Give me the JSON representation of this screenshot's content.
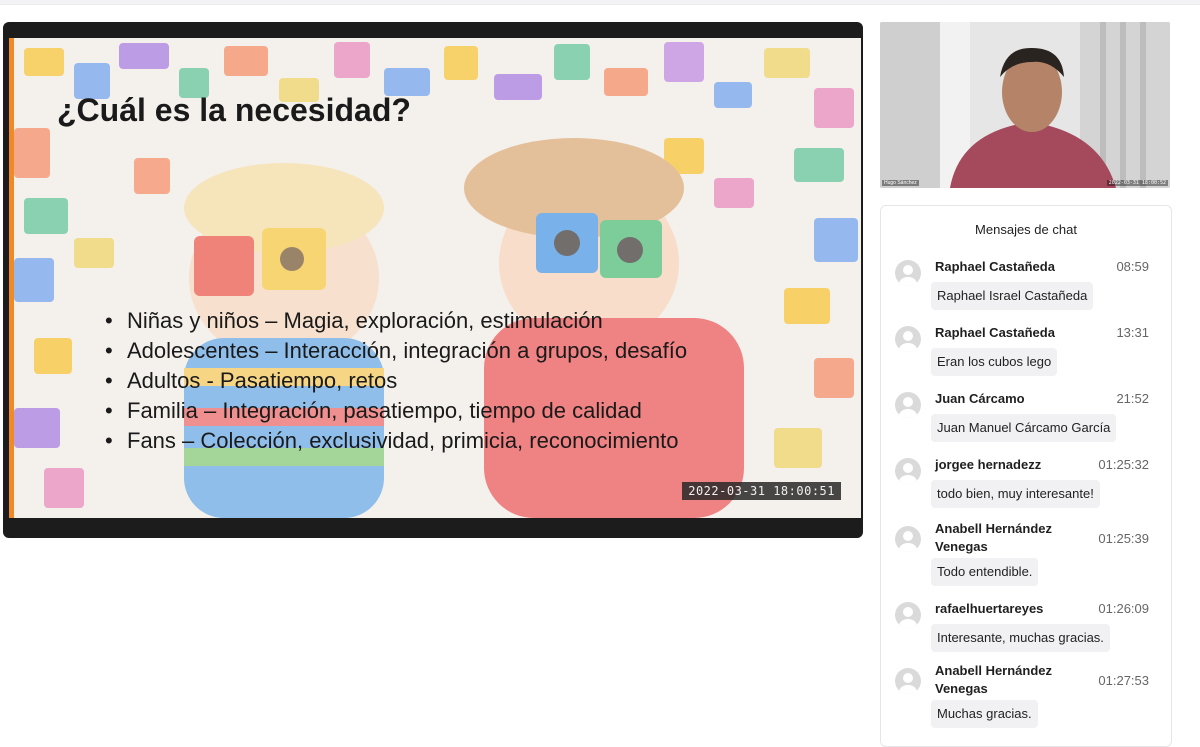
{
  "slide": {
    "title": "¿Cuál es la necesidad?",
    "bullets": [
      "Niñas y niños – Magia, exploración, estimulación",
      "Adolescentes – Interacción, integración a grupos, desafío",
      "Adultos - Pasatiempo, retos",
      "Familia – Integración, pasatiempo, tiempo de calidad",
      "Fans – Colección, exclusividad, primicia, reconocimiento"
    ],
    "timestamp": "2022-03-31  18:00:51",
    "accent_color": "#f08a24"
  },
  "webcam": {
    "name_tag": "Hugo Sánchez",
    "timestamp": "2022-03-31 18:00:52"
  },
  "chat": {
    "title": "Mensajes de chat",
    "messages": [
      {
        "author": "Raphael Castañeda",
        "time": "08:59",
        "text": "Raphael Israel Castañeda"
      },
      {
        "author": "Raphael Castañeda",
        "time": "13:31",
        "text": "Eran los cubos lego"
      },
      {
        "author": "Juan Cárcamo",
        "time": "21:52",
        "text": "Juan Manuel Cárcamo García"
      },
      {
        "author": "jorgee hernadezz",
        "time": "01:25:32",
        "text": "todo bien, muy interesante!"
      },
      {
        "author": "Anabell Hernández Venegas",
        "time": "01:25:39",
        "text": "Todo entendible."
      },
      {
        "author": "rafaelhuertareyes",
        "time": "01:26:09",
        "text": "Interesante, muchas gracias."
      },
      {
        "author": "Anabell Hernández Venegas",
        "time": "01:27:53",
        "text": "Muchas gracias."
      }
    ]
  }
}
